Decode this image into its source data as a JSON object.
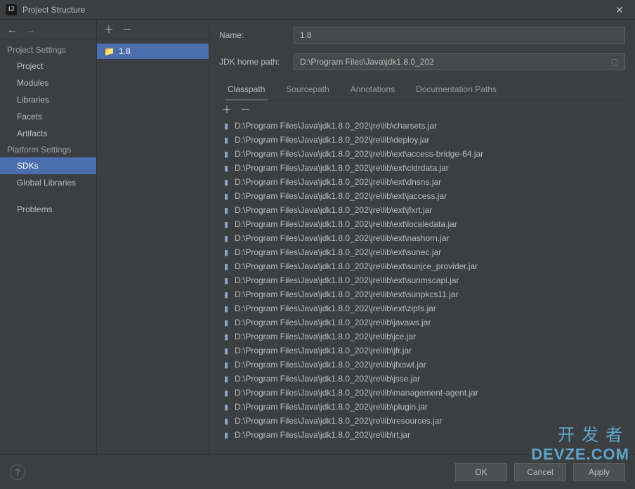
{
  "window": {
    "title": "Project Structure",
    "appIconLetter": "IJ"
  },
  "sidebar": {
    "sections": [
      {
        "header": "Project Settings",
        "items": [
          "Project",
          "Modules",
          "Libraries",
          "Facets",
          "Artifacts"
        ]
      },
      {
        "header": "Platform Settings",
        "items": [
          "SDKs",
          "Global Libraries"
        ]
      },
      {
        "header": null,
        "items": [
          "Problems"
        ]
      }
    ],
    "selected": "SDKs"
  },
  "sdkList": {
    "items": [
      "1.8"
    ],
    "selected": "1.8"
  },
  "form": {
    "nameLabel": "Name:",
    "nameValue": "1.8",
    "pathLabel": "JDK home path:",
    "pathValue": "D:\\Program Files\\Java\\jdk1.8.0_202"
  },
  "tabs": {
    "items": [
      "Classpath",
      "Sourcepath",
      "Annotations",
      "Documentation Paths"
    ],
    "active": "Classpath"
  },
  "classpath": [
    "D:\\Program Files\\Java\\jdk1.8.0_202\\jre\\lib\\charsets.jar",
    "D:\\Program Files\\Java\\jdk1.8.0_202\\jre\\lib\\deploy.jar",
    "D:\\Program Files\\Java\\jdk1.8.0_202\\jre\\lib\\ext\\access-bridge-64.jar",
    "D:\\Program Files\\Java\\jdk1.8.0_202\\jre\\lib\\ext\\cldrdata.jar",
    "D:\\Program Files\\Java\\jdk1.8.0_202\\jre\\lib\\ext\\dnsns.jar",
    "D:\\Program Files\\Java\\jdk1.8.0_202\\jre\\lib\\ext\\jaccess.jar",
    "D:\\Program Files\\Java\\jdk1.8.0_202\\jre\\lib\\ext\\jfxrt.jar",
    "D:\\Program Files\\Java\\jdk1.8.0_202\\jre\\lib\\ext\\localedata.jar",
    "D:\\Program Files\\Java\\jdk1.8.0_202\\jre\\lib\\ext\\nashorn.jar",
    "D:\\Program Files\\Java\\jdk1.8.0_202\\jre\\lib\\ext\\sunec.jar",
    "D:\\Program Files\\Java\\jdk1.8.0_202\\jre\\lib\\ext\\sunjce_provider.jar",
    "D:\\Program Files\\Java\\jdk1.8.0_202\\jre\\lib\\ext\\sunmscapi.jar",
    "D:\\Program Files\\Java\\jdk1.8.0_202\\jre\\lib\\ext\\sunpkcs11.jar",
    "D:\\Program Files\\Java\\jdk1.8.0_202\\jre\\lib\\ext\\zipfs.jar",
    "D:\\Program Files\\Java\\jdk1.8.0_202\\jre\\lib\\javaws.jar",
    "D:\\Program Files\\Java\\jdk1.8.0_202\\jre\\lib\\jce.jar",
    "D:\\Program Files\\Java\\jdk1.8.0_202\\jre\\lib\\jfr.jar",
    "D:\\Program Files\\Java\\jdk1.8.0_202\\jre\\lib\\jfxswt.jar",
    "D:\\Program Files\\Java\\jdk1.8.0_202\\jre\\lib\\jsse.jar",
    "D:\\Program Files\\Java\\jdk1.8.0_202\\jre\\lib\\management-agent.jar",
    "D:\\Program Files\\Java\\jdk1.8.0_202\\jre\\lib\\plugin.jar",
    "D:\\Program Files\\Java\\jdk1.8.0_202\\jre\\lib\\resources.jar",
    "D:\\Program Files\\Java\\jdk1.8.0_202\\jre\\lib\\rt.jar"
  ],
  "footer": {
    "ok": "OK",
    "cancel": "Cancel",
    "apply": "Apply"
  },
  "watermark": {
    "cn": "开发者",
    "en": "DEVZE.COM"
  }
}
